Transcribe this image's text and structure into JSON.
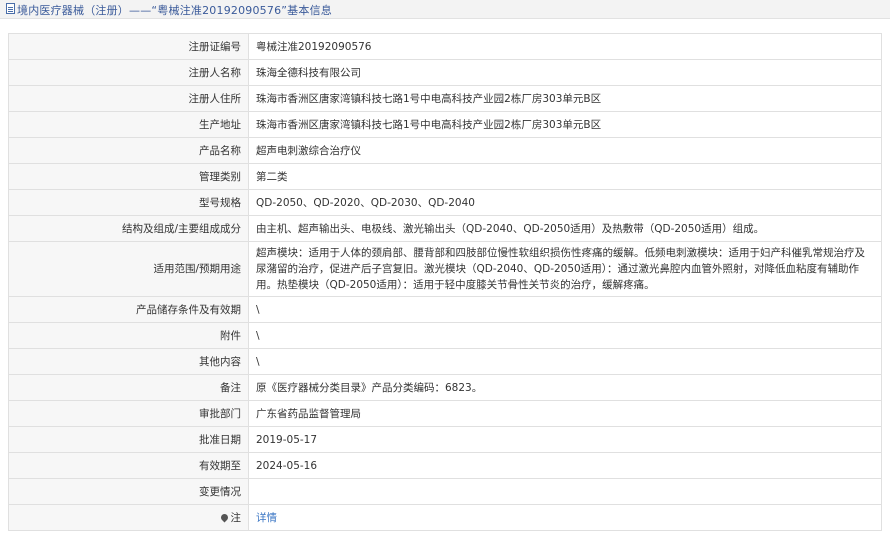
{
  "header": {
    "title": "境内医疗器械（注册）——“粤械注准20192090576”基本信息"
  },
  "rows": [
    {
      "label": "注册证编号",
      "value": "粤械注准20192090576"
    },
    {
      "label": "注册人名称",
      "value": "珠海全德科技有限公司"
    },
    {
      "label": "注册人住所",
      "value": "珠海市香洲区唐家湾镇科技七路1号中电高科技产业园2栋厂房303单元B区"
    },
    {
      "label": "生产地址",
      "value": "珠海市香洲区唐家湾镇科技七路1号中电高科技产业园2栋厂房303单元B区"
    },
    {
      "label": "产品名称",
      "value": "超声电刺激综合治疗仪"
    },
    {
      "label": "管理类别",
      "value": "第二类"
    },
    {
      "label": "型号规格",
      "value": "QD-2050、QD-2020、QD-2030、QD-2040"
    },
    {
      "label": "结构及组成/主要组成成分",
      "value": "由主机、超声输出头、电极线、激光输出头（QD-2040、QD-2050适用）及热敷带（QD-2050适用）组成。"
    },
    {
      "label": "适用范围/预期用途",
      "value": "超声模块：适用于人体的颈肩部、腰背部和四肢部位慢性软组织损伤性疼痛的缓解。低频电刺激模块：适用于妇产科催乳常规治疗及尿潴留的治疗，促进产后子宫复旧。激光模块（QD-2040、QD-2050适用）：通过激光鼻腔内血管外照射，对降低血粘度有辅助作用。热垫模块（QD-2050适用）：适用于轻中度膝关节骨性关节炎的治疗，缓解疼痛。"
    },
    {
      "label": "产品储存条件及有效期",
      "value": "\\"
    },
    {
      "label": "附件",
      "value": "\\"
    },
    {
      "label": "其他内容",
      "value": "\\"
    },
    {
      "label": "备注",
      "value": "原《医疗器械分类目录》产品分类编码：6823。"
    },
    {
      "label": "审批部门",
      "value": "广东省药品监督管理局"
    },
    {
      "label": "批准日期",
      "value": "2019-05-17"
    },
    {
      "label": "有效期至",
      "value": "2024-05-16"
    },
    {
      "label": "变更情况",
      "value": ""
    },
    {
      "label": "注",
      "value": "详情"
    }
  ]
}
